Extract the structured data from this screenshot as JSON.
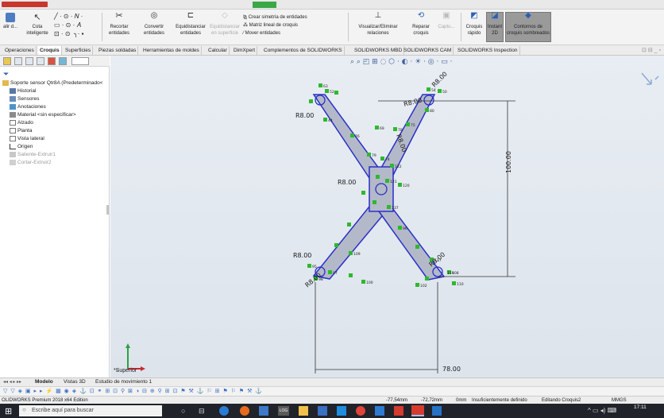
{
  "ribbon": {
    "salir_label": "alir d...",
    "cota_label": "Cota inteligente",
    "recortar_label": "Recortar entidades",
    "convertir_label": "Convertir entidades",
    "equid_label1": "Equidistanciar",
    "equid_label2": "entidades",
    "equid_sup1": "Equidistanciar",
    "equid_sup2": "en superficie",
    "simetria_label": "Crear simetría de entidades",
    "matriz_label": "Matriz lineal de croquis",
    "mover_label": "Mover entidades",
    "visualizar_label": "Visualizar/Eliminar relaciones",
    "reparar_label1": "Reparar",
    "reparar_label2": "croquis",
    "captura_label": "Captu...",
    "croquis_rapido1": "Croquis",
    "croquis_rapido2": "rápido",
    "instant1": "Instant",
    "instant2": "2D",
    "contornos1": "Contornos de",
    "contornos2": "croquis sombreados"
  },
  "tabs": [
    "Operaciones",
    "Croquis",
    "Superficies",
    "Piezas soldadas",
    "Herramientas de moldes",
    "Calcular",
    "DimXpert",
    "Complementos de SOLIDWORKS",
    "SOLIDWORKS MBD",
    "SOLIDWORKS CAM",
    "SOLIDWORKS Inspection"
  ],
  "tree": {
    "root": "Soporte sensor Qtr8A  (Predeterminado<",
    "items": [
      "Historial",
      "Sensores",
      "Anotaciones",
      "Material <sin especificar>",
      "Alzado",
      "Planta",
      "Vista lateral",
      "Origen",
      "Saliente-Extruir1",
      "Cortar-Extruir2"
    ]
  },
  "canvas": {
    "dims": {
      "r1": "R8.00",
      "r2": "R8.00",
      "r3": "R8.00",
      "r4": "R8.00",
      "r5": "R8.00",
      "r6": "R8.00",
      "r7": "R8.00",
      "r8": "R8.00"
    },
    "height_dim": "100.00",
    "width_dim": "78.00",
    "view_label": "*Superior",
    "relation_labels": [
      "63",
      "52",
      "50",
      "54",
      "44",
      "80",
      "76",
      "75",
      "78",
      "79",
      "69",
      "74",
      "120",
      "122",
      "121",
      "137",
      "108",
      "109",
      "117",
      "100",
      "102",
      "119",
      "97",
      "98",
      "110",
      "95",
      "96"
    ]
  },
  "bottom_tabs": [
    "Modelo",
    "Vistas 3D",
    "Estudio de movimiento 1"
  ],
  "status": {
    "edition": "OLIDWORKS Premium 2018 x64 Edition",
    "x": "-77,54mm",
    "y": "-72,72mm",
    "z": "0mm",
    "defined": "Insuficientemente definido",
    "editing": "Editando Croquis2",
    "units": "MMGS"
  },
  "taskbar": {
    "search_placeholder": "Escribe aquí para buscar",
    "time": "17:11"
  },
  "colors": {
    "sketch_fill": "#b4b9c9",
    "sketch_line": "#2a30c8",
    "relation_green": "#2fb82f",
    "dim_text": "#1a1a1a"
  }
}
